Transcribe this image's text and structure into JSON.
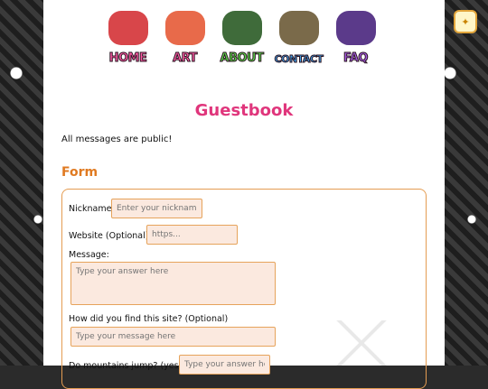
{
  "nav": {
    "items": [
      {
        "label": "HOME",
        "icon": "red-creature-icon",
        "color": "#d8464a"
      },
      {
        "label": "ART",
        "icon": "palette-icon",
        "color": "#e86a4a"
      },
      {
        "label": "ABOUT",
        "icon": "green-cube-icon",
        "color": "#3f6b3a"
      },
      {
        "label": "CONTACT",
        "icon": "character-icon",
        "color": "#7a6a4a"
      },
      {
        "label": "FAQ",
        "icon": "wizard-hat-icon",
        "color": "#5b3a8a"
      }
    ]
  },
  "lamp_icon": "lightbulb-icon",
  "page": {
    "title": "Guestbook",
    "intro": "All messages are public!"
  },
  "form": {
    "heading": "Form",
    "nickname_label": "Nickname:",
    "nickname_placeholder": "Enter your nickname",
    "website_label": "Website (Optional):",
    "website_placeholder": "https...",
    "message_label": "Message:",
    "message_placeholder": "Type your answer here",
    "found_label": "How did you find this site? (Optional)",
    "found_placeholder": "Type your message here",
    "jump_label": "Do mountains jump? (yes/no)",
    "jump_placeholder": "Type your answer here"
  },
  "colors": {
    "accent_pink": "#e0367c",
    "accent_orange": "#e07a21",
    "input_bg": "#fbe9df"
  }
}
